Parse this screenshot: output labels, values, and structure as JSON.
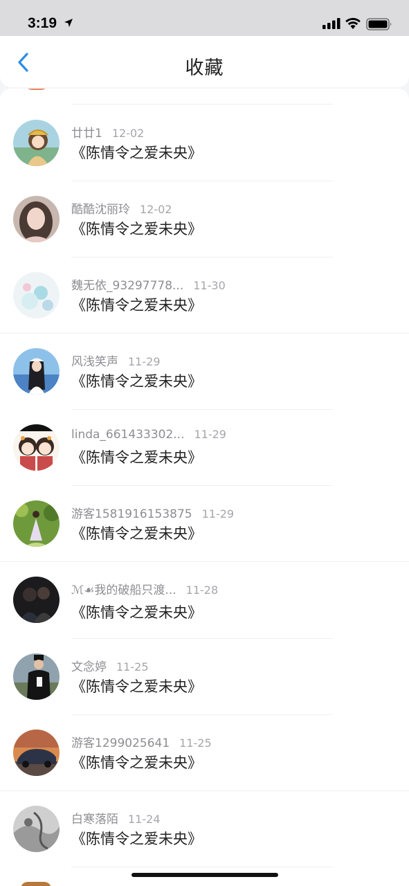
{
  "status_bar": {
    "time": "3:19",
    "icons": [
      "location-arrow-icon",
      "cellular-signal-icon",
      "wifi-icon",
      "battery-icon"
    ]
  },
  "header": {
    "title": "收藏",
    "back_icon": "chevron-left-icon"
  },
  "colors": {
    "accent": "#2a8ee6",
    "meta_text": "#8e8e93",
    "divider": "#efefef"
  },
  "items": [
    {
      "username": "廿廿1",
      "date": "12-02",
      "title": "《陈情令之爱未央》",
      "avatar": "anime-girl-avatar"
    },
    {
      "username": "酷酷沈丽玲",
      "date": "12-02",
      "title": "《陈情令之爱未央》",
      "avatar": "woman-portrait-avatar"
    },
    {
      "username": "魏无依_93297778...",
      "date": "11-30",
      "title": "《陈情令之爱未央》",
      "avatar": "pastel-illustration-avatar"
    },
    {
      "username": "风浅笑声",
      "date": "11-29",
      "title": "《陈情令之爱未央》",
      "avatar": "girl-lake-avatar"
    },
    {
      "username": "linda_661433302...",
      "date": "11-29",
      "title": "《陈情令之爱未央》",
      "avatar": "chibi-couple-avatar"
    },
    {
      "username": "游客1581916153875",
      "date": "11-29",
      "title": "《陈情令之爱未央》",
      "avatar": "girl-garden-avatar"
    },
    {
      "username": "ℳ☙我的破船只渡...",
      "date": "11-28",
      "title": "《陈情令之爱未央》",
      "avatar": "dark-couple-avatar"
    },
    {
      "username": "文念婷",
      "date": "11-25",
      "title": "《陈情令之爱未央》",
      "avatar": "man-street-avatar"
    },
    {
      "username": "游客1299025641",
      "date": "11-25",
      "title": "《陈情令之爱未央》",
      "avatar": "sports-car-avatar"
    },
    {
      "username": "白寒落陌",
      "date": "11-24",
      "title": "《陈情令之爱未央》",
      "avatar": "gray-sketch-avatar"
    }
  ]
}
